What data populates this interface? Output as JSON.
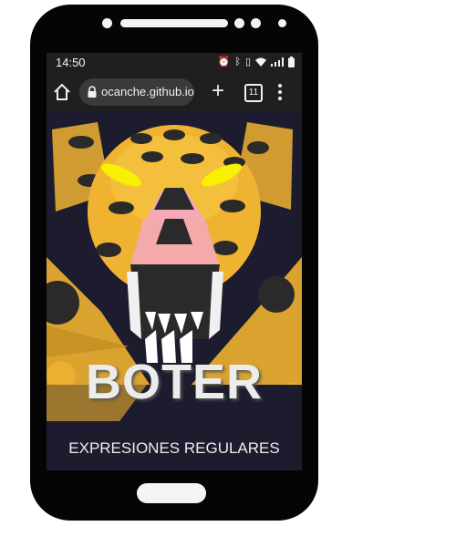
{
  "status_bar": {
    "time": "14:50",
    "icons": [
      "alarm-icon",
      "bluetooth-icon",
      "vibrate-icon",
      "wifi-icon",
      "signal-icon",
      "battery-icon"
    ]
  },
  "browser": {
    "url": "ocanche.github.io",
    "tab_count": "11",
    "new_tab_label": "+"
  },
  "page": {
    "title": "BOTER",
    "subtitle": "EXPRESIONES REGULARES"
  },
  "colors": {
    "jaguar_yellow": "#f0b331",
    "spot": "#2a2a2a",
    "eye": "#f7f000",
    "nose_pink": "#f5a9b8",
    "background": "#1d1c2e"
  }
}
